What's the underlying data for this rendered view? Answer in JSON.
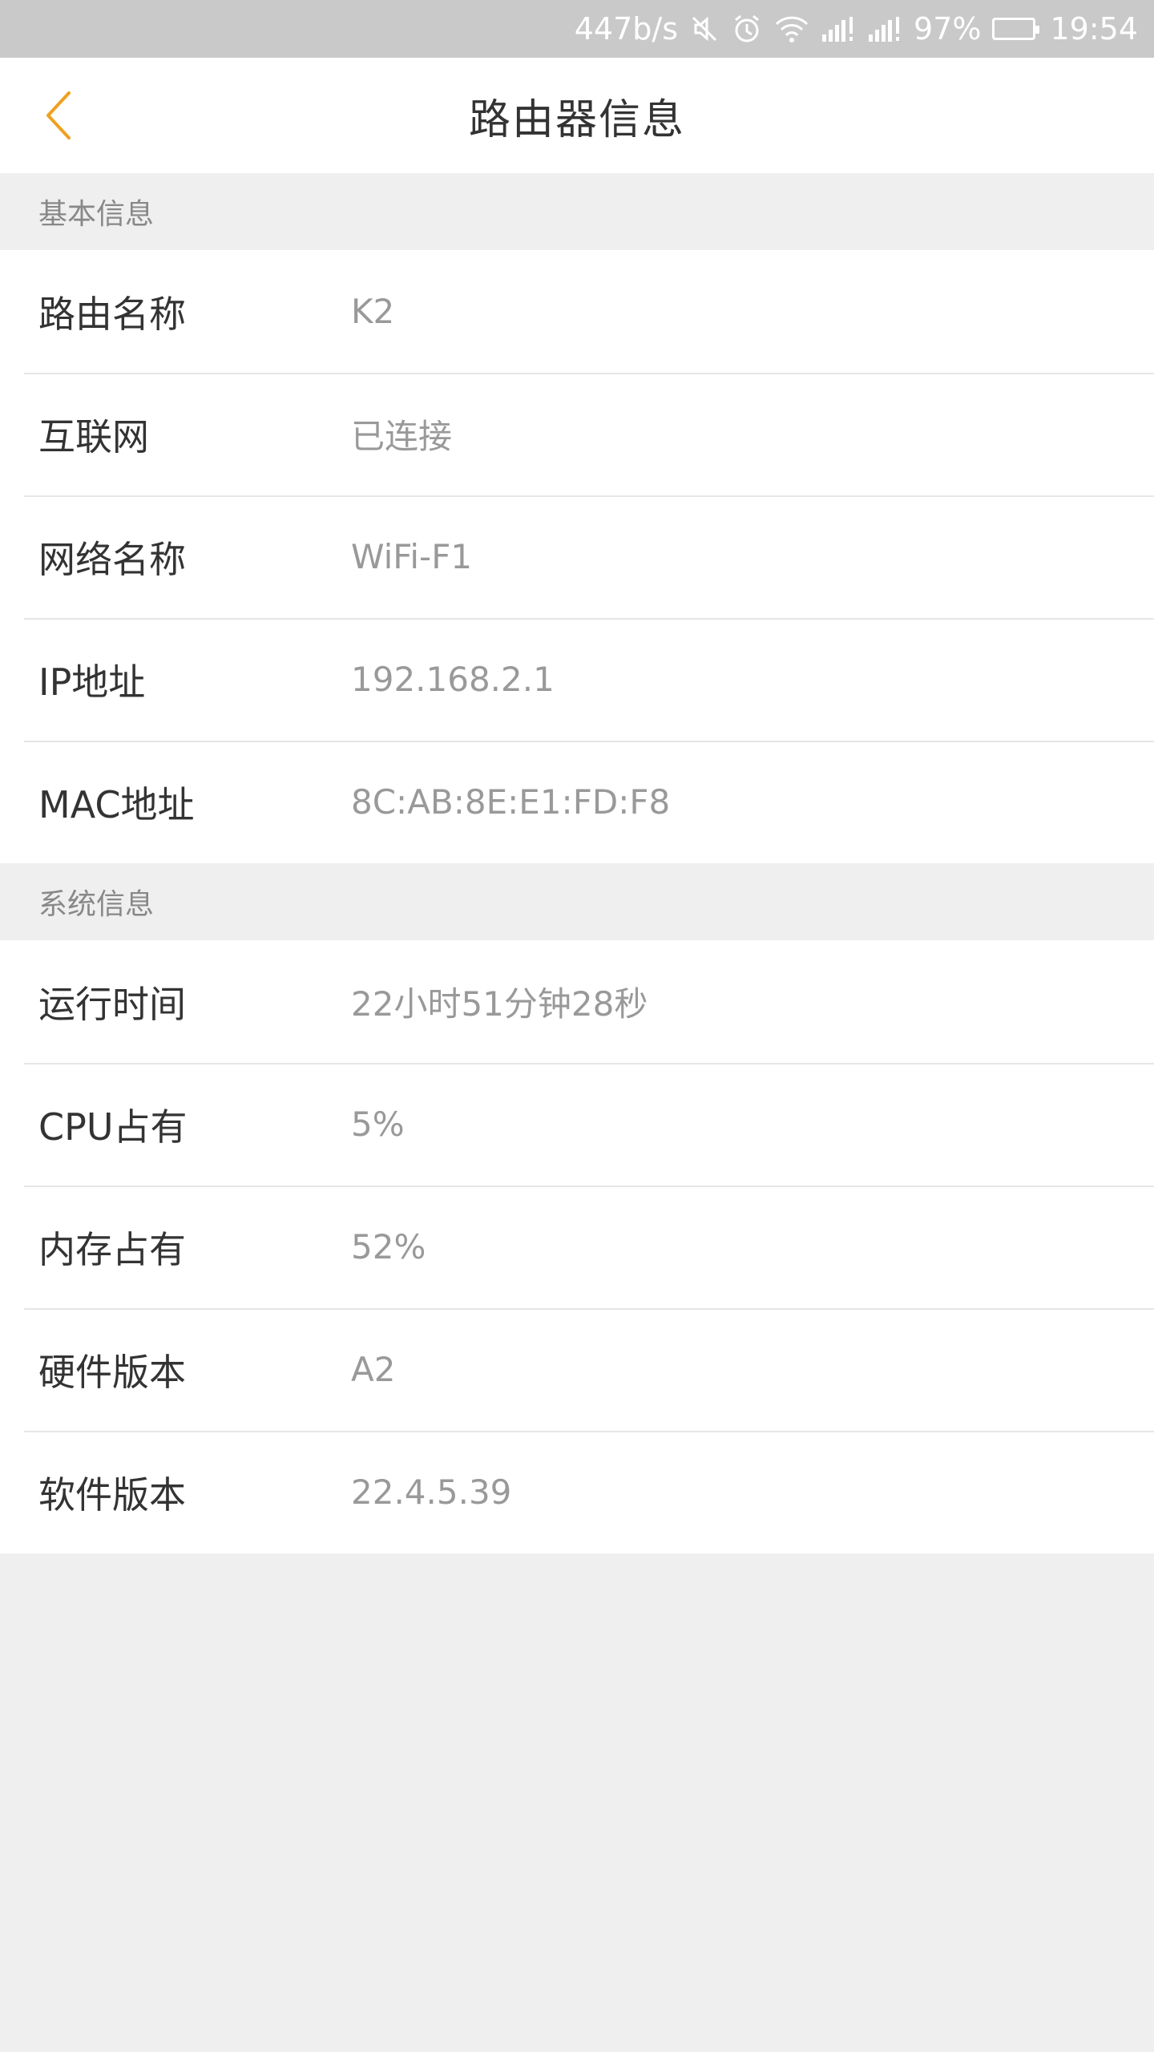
{
  "status_bar": {
    "net_speed": "447b/s",
    "mute_icon": "mute-icon",
    "alarm_icon": "alarm-icon",
    "wifi_icon": "wifi-icon",
    "signal_icon": "signal-icon",
    "battery_percent": "97%",
    "battery_level": 0.97,
    "battery_color": "#22dd22",
    "time": "19:54"
  },
  "app_bar": {
    "back_icon": "chevron-left-icon",
    "accent_color": "#f0a020",
    "title": "路由器信息"
  },
  "sections": [
    {
      "header": "基本信息",
      "rows": [
        {
          "label": "路由名称",
          "value": "K2"
        },
        {
          "label": "互联网",
          "value": "已连接"
        },
        {
          "label": "网络名称",
          "value": "WiFi-F1"
        },
        {
          "label": "IP地址",
          "value": "192.168.2.1"
        },
        {
          "label": "MAC地址",
          "value": "8C:AB:8E:E1:FD:F8"
        }
      ]
    },
    {
      "header": "系统信息",
      "rows": [
        {
          "label": "运行时间",
          "value": "22小时51分钟28秒"
        },
        {
          "label": "CPU占有",
          "value": "5%"
        },
        {
          "label": "内存占有",
          "value": "52%"
        },
        {
          "label": "硬件版本",
          "value": "A2"
        },
        {
          "label": "软件版本",
          "value": "22.4.5.39"
        }
      ]
    }
  ]
}
